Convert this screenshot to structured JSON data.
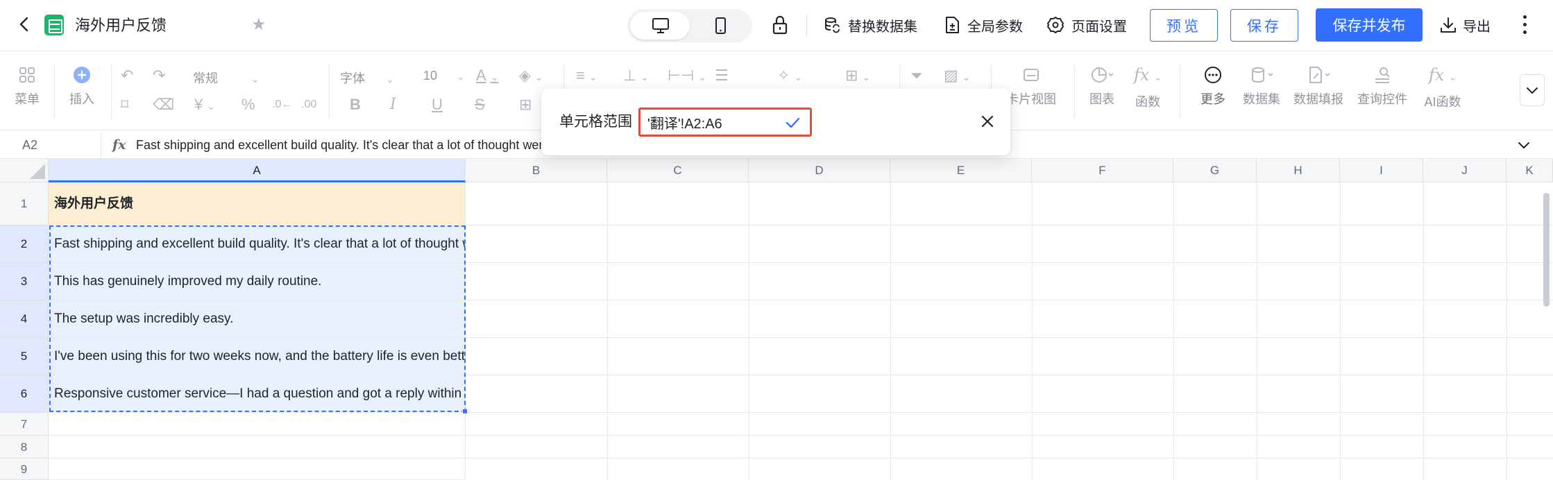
{
  "header": {
    "title": "海外用户反馈",
    "replace_dataset": "替换数据集",
    "global_params": "全局参数",
    "page_settings": "页面设置",
    "preview": "预览",
    "save": "保存",
    "save_publish": "保存并发布",
    "export": "导出"
  },
  "ribbon": {
    "menu": "菜单",
    "insert": "插入",
    "number_format": "常规",
    "font": "字体",
    "font_size": "10",
    "card_view": "卡片视图",
    "chart": "图表",
    "function": "函数",
    "more": "更多",
    "dataset": "数据集",
    "data_fill": "数据填报",
    "query_control": "查询控件",
    "ai_function": "AI函数"
  },
  "formula_bar": {
    "cell_ref": "A2",
    "fx": "fx",
    "content": "Fast shipping and excellent build quality. It's clear that a lot of thought wer"
  },
  "grid": {
    "columns": [
      "A",
      "B",
      "C",
      "D",
      "E",
      "F",
      "G",
      "H",
      "I",
      "J",
      "K"
    ],
    "rows": [
      "1",
      "2",
      "3",
      "4",
      "5",
      "6",
      "7",
      "8",
      "9"
    ],
    "cells": {
      "A1": "海外用户反馈",
      "A2": "Fast shipping and excellent build quality. It's clear that a lot of thought went into it.",
      "A3": "This has genuinely improved my daily routine.",
      "A4": "The setup was incredibly easy.",
      "A5": "I've been using this for two weeks now, and the battery life is even better than expected.",
      "A6": "Responsive customer service—I had a question and got a reply within hours."
    }
  },
  "range_popover": {
    "label": "单元格范围",
    "value": "'翻译'!A2:A6"
  },
  "colors": {
    "accent": "#3370ff",
    "title_fill": "#fdeed3",
    "selection_fill": "#e8f0fe",
    "range_border": "#e34d3e"
  }
}
